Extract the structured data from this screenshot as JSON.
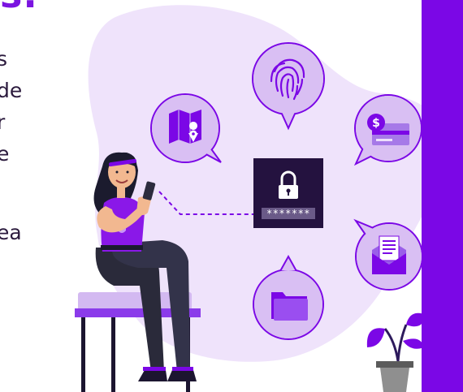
{
  "heading": {
    "fragment": "s."
  },
  "body_text": {
    "lines": [
      "s",
      "de",
      "r",
      "e",
      "",
      "ea"
    ]
  },
  "password_card": {
    "mask": "*******"
  },
  "colors": {
    "accent": "#7b07e6",
    "blob": "#efe3fb",
    "bubble": "#d9bff3",
    "dark_panel": "#24123f"
  },
  "icons": [
    "map-pin-icon",
    "fingerprint-icon",
    "credit-card-icon",
    "lock-icon",
    "email-icon",
    "folder-icon",
    "plant-icon"
  ]
}
